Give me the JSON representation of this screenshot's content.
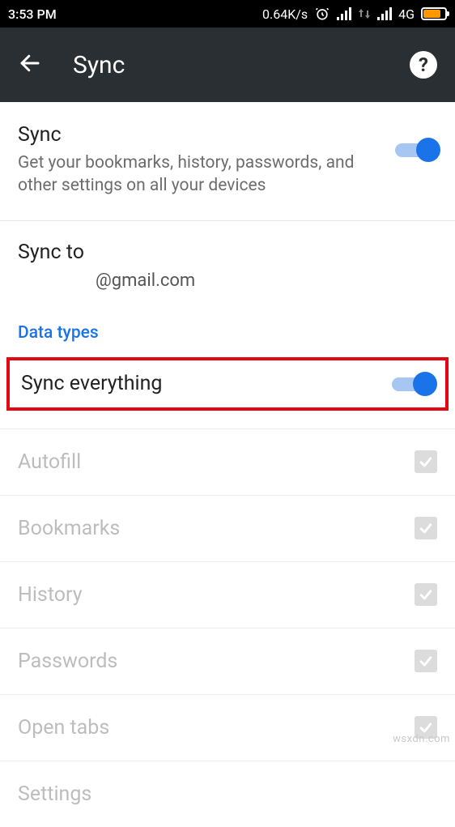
{
  "status": {
    "time": "3:53 PM",
    "speed": "0.64K/s",
    "network_label": "4G"
  },
  "appbar": {
    "title": "Sync",
    "help_symbol": "?"
  },
  "sync": {
    "title": "Sync",
    "description": "Get your bookmarks, history, passwords, and other settings on all your devices"
  },
  "sync_to": {
    "title": "Sync to",
    "email": "@gmail.com"
  },
  "section": {
    "data_types": "Data types"
  },
  "rows": {
    "sync_everything": "Sync everything",
    "autofill": "Autofill",
    "bookmarks": "Bookmarks",
    "history": "History",
    "passwords": "Passwords",
    "open_tabs": "Open tabs",
    "settings": "Settings"
  },
  "watermark": "wsxdn.com"
}
